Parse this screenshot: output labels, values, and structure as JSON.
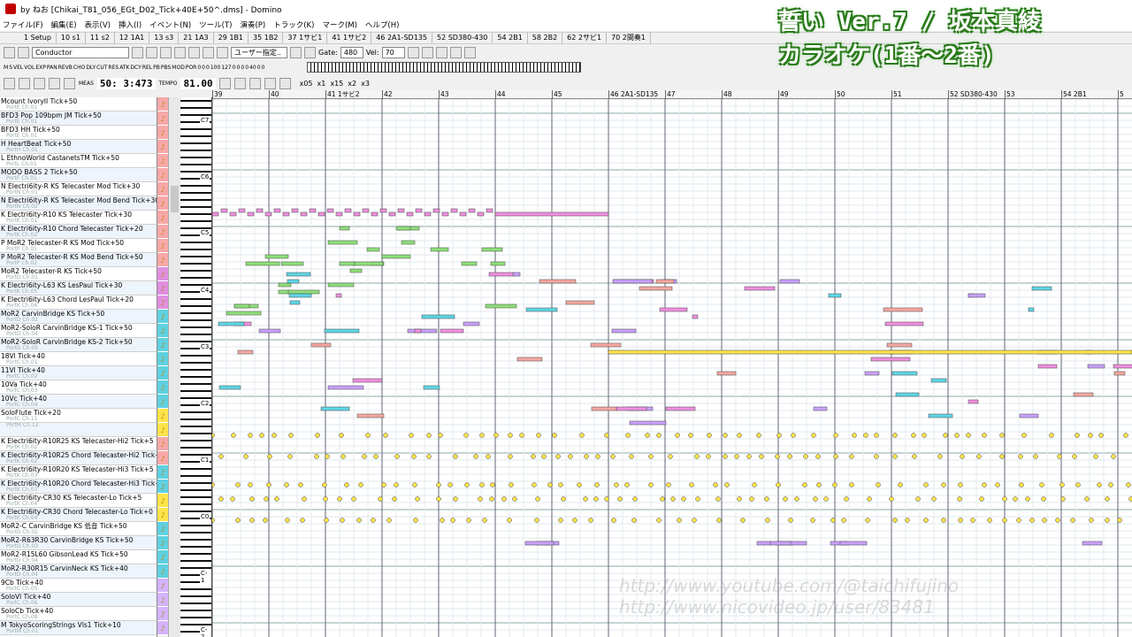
{
  "window": {
    "title": "by ねお [Chikai_T81_056_EGt_D02_Tick+40E+50^.dms] - Domino"
  },
  "menu": [
    "ファイル(F)",
    "編集(E)",
    "表示(V)",
    "挿入(I)",
    "イベント(N)",
    "ツール(T)",
    "演奏(P)",
    "トラック(K)",
    "マーク(M)",
    "ヘルプ(H)"
  ],
  "markers": [
    "1 Setup",
    "10 s1",
    "11 s2",
    "12 1A1",
    "13 s3",
    "21 1A3",
    "29 1B1",
    "35 1B2",
    "37 1サビ1",
    "41 1サビ2",
    "46 2A1-SD135",
    "52 SD380-430",
    "54 2B1",
    "58 2B2",
    "62 2サビ1",
    "70 2間奏1"
  ],
  "toolbar": {
    "track_select": "Conductor",
    "gate_label": "Gate:",
    "gate_value": "480",
    "vel_label": "Vel:",
    "vel_value": "70",
    "quantize": "ユーザー指定..",
    "meas_label": "MEAS",
    "position": "50: 3:473",
    "tempo_label": "TEMPO",
    "tempo": "81.00",
    "zoom_x": [
      "x05",
      "x1",
      "x15",
      "x2",
      "x3"
    ]
  },
  "meter_labels": [
    "M",
    "S",
    "VEL",
    "VOL",
    "EXP",
    "PAN",
    "REVB",
    "CHO",
    "DLY",
    "CUT",
    "RES",
    "ATK",
    "DCY",
    "REL",
    "PB",
    "PBS",
    "MOD",
    "POR"
  ],
  "meter_values": [
    "0",
    "0",
    "0",
    "100",
    "127",
    "0",
    "0",
    "0",
    "0",
    "40",
    "0",
    "0"
  ],
  "overlay": {
    "line1": "誓い Ver.7 / 坂本真綾",
    "line2": "カラオケ(1番〜2番)"
  },
  "watermark": {
    "line1": "http://www.youtube.com/@taichifujino",
    "line2": "http://www.nicovideo.jp/user/83481"
  },
  "tracks": [
    {
      "name": "Mcount IvoryII Tick+50",
      "sub": "PortE Ch.01"
    },
    {
      "name": "BFD3 Pop 109bpm JM Tick+50",
      "sub": "PortE Ch.01"
    },
    {
      "name": "BFD3 HH Tick+50",
      "sub": "PortE Ch.01"
    },
    {
      "name": "H HeartBeat Tick+50",
      "sub": "PortH Ch.01"
    },
    {
      "name": "L EthnoWorld CastanetsTM Tick+50",
      "sub": "PortL Ch.01"
    },
    {
      "name": "MODO BASS 2 Tick+50",
      "sub": "PortF Ch.01"
    },
    {
      "name": "N Electri6ity-R KS Telecaster Mod Tick+30",
      "sub": "PortN Ch.01"
    },
    {
      "name": "N Electri6ity-R KS Telecaster Mod Bend Tick+30",
      "sub": "PortN Ch.02"
    },
    {
      "name": "K Electri6ity-R10 KS Telecaster Tick+30",
      "sub": "PortK Ch.01"
    },
    {
      "name": "K Electri6ity-R10 Chord Telecaster Tick+20",
      "sub": "PortK Ch.02"
    },
    {
      "name": "P MoR2 Telecaster-R KS Mod Tick+50",
      "sub": "PortP Ch.01"
    },
    {
      "name": "P MoR2 Telecaster-R KS Mod Bend Tick+50",
      "sub": "PortP Ch.02"
    },
    {
      "name": "MoR2 Telecaster-R KS Tick+50",
      "sub": "PortD Ch.01"
    },
    {
      "name": "K Electri6ity-L63 KS LesPaul Tick+30",
      "sub": "PortK Ch.05"
    },
    {
      "name": "K Electri6ity-L63 Chord LesPaul Tick+20",
      "sub": "PortK Ch.06"
    },
    {
      "name": "MoR2 CarvinBridge KS Tick+50",
      "sub": "PortD Ch.02"
    },
    {
      "name": "MoR2-SoloR CarvinBridge KS-1 Tick+50",
      "sub": "PortD Ch.04"
    },
    {
      "name": "MoR2-SoloR CarvinBridge KS-2 Tick+50",
      "sub": "PortD Ch.05"
    },
    {
      "name": "18Vl Tick+40",
      "sub": "PortC Ch.01"
    },
    {
      "name": "11Vl Tick+40",
      "sub": "PortC Ch.02"
    },
    {
      "name": "10Va Tick+40",
      "sub": "PortC Ch.03"
    },
    {
      "name": "10Vc Tick+40",
      "sub": "PortC Ch.04"
    },
    {
      "name": "SoloFlute Tick+20",
      "sub": "PortC Ch.11"
    },
    {
      "name": "",
      "sub": "PortM Ch.12"
    },
    {
      "name": "K Electri6ity-R10R25 KS Telecaster-Hi2 Tick+5",
      "sub": "PortK Ch.02"
    },
    {
      "name": "K Electri6ity-R10R25 Chord Telecaster-Hi2 Tick+0",
      "sub": "PortK Ch.02"
    },
    {
      "name": "K Electri6ity-R10R20 KS Telecaster-Hi3 Tick+5",
      "sub": "PortK Ch.03"
    },
    {
      "name": "K Electri6ity-R10R20 Chord Telecaster-Hi3 Tick+0",
      "sub": "PortK Ch.03"
    },
    {
      "name": "K Electri6ity-CR30 KS Telecaster-Lo Tick+5",
      "sub": "PortK Ch.04"
    },
    {
      "name": "K Electri6ity-CR30 Chord Telecaster-Lo Tick+0",
      "sub": "PortK Ch.04"
    },
    {
      "name": "MoR2-C CarvinBridge KS 低音 Tick+50",
      "sub": "PortD Ch.02"
    },
    {
      "name": "MoR2-R63R30 CarvinBridge KS Tick+50",
      "sub": "PortD Ch.03"
    },
    {
      "name": "MoR2-R15L60 GibsonLead KS Tick+50",
      "sub": "PortD Ch.04"
    },
    {
      "name": "MoR2-R30R15 CarvinNeck KS Tick+40",
      "sub": "PortD Ch.04"
    },
    {
      "name": "9Cb Tick+40",
      "sub": "PortC Ch.05"
    },
    {
      "name": "SoloVl Tick+40",
      "sub": "PortC Ch.06"
    },
    {
      "name": "SoloCb Tick+40",
      "sub": "PortC Ch.08"
    },
    {
      "name": "M TokyoScoringStrings Vls1 Tick+10",
      "sub": "PortM Ch.01"
    }
  ],
  "track_colors": [
    "#f7a8a8",
    "#f7a8a8",
    "#f7a8a8",
    "#f7a8a8",
    "#f7a8a8",
    "#f7a8a8",
    "#f7a8a8",
    "#f7a8a8",
    "#f7a8a8",
    "#f7a8a8",
    "#f7a8a8",
    "#f7a8a8",
    "#e08fe0",
    "#e08fe0",
    "#e08fe0",
    "#5fd0e0",
    "#5fd0e0",
    "#5fd0e0",
    "#5fd0e0",
    "#5fd0e0",
    "#5fd0e0",
    "#5fd0e0",
    "#ffe34a",
    "#ffe34a",
    "#f7a8a8",
    "#f7a8a8",
    "#5fd0e0",
    "#5fd0e0",
    "#ffe34a",
    "#ffe34a",
    "#5fd0e0",
    "#5fd0e0",
    "#5fd0e0",
    "#5fd0e0",
    "#d4b3ff",
    "#d4b3ff",
    "#d4b3ff",
    "#d4b3ff"
  ],
  "measure_labels": [
    {
      "m": "39"
    },
    {
      "m": "40"
    },
    {
      "m": "41 1サビ2"
    },
    {
      "m": "42"
    },
    {
      "m": "43"
    },
    {
      "m": "44"
    },
    {
      "m": "45"
    },
    {
      "m": "46 2A1-SD135"
    },
    {
      "m": "47"
    },
    {
      "m": "48"
    },
    {
      "m": "49"
    },
    {
      "m": "50"
    },
    {
      "m": "51"
    },
    {
      "m": "52 SD380-430"
    },
    {
      "m": "53"
    },
    {
      "m": "54 2B1"
    },
    {
      "m": "5"
    }
  ],
  "octaves": [
    "C7",
    "C6",
    "C5",
    "C4",
    "C3",
    "C2",
    "C1",
    "C0",
    "C-1",
    "C-2"
  ],
  "note_colors": {
    "green": "#8ee07a",
    "cyan": "#5fd6e6",
    "pink": "#f08fe0",
    "salmon": "#f5a8a0",
    "violet": "#c9a0ff",
    "yellow": "#ffe34a"
  }
}
